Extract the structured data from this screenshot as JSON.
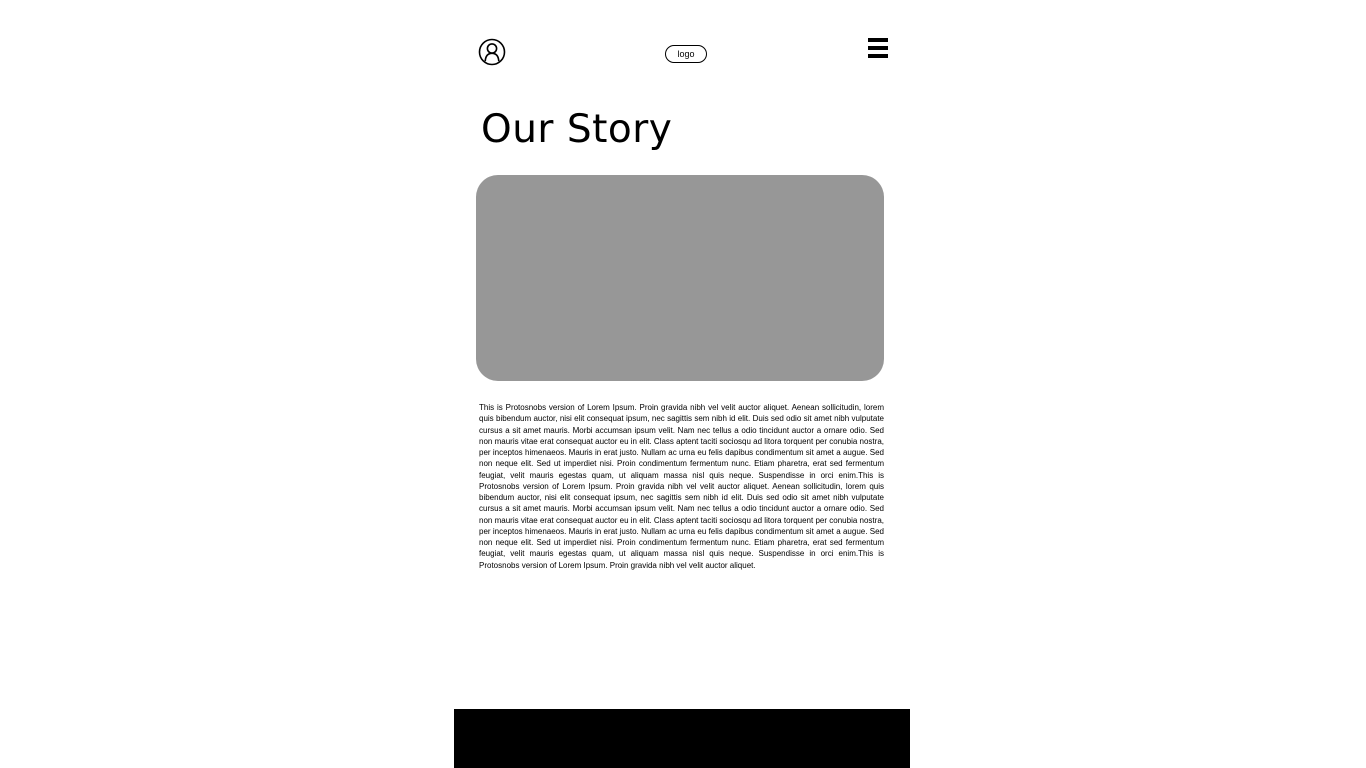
{
  "header": {
    "logo_text": "logo",
    "user_icon": "user-profile-icon",
    "menu_icon": "hamburger-menu-icon"
  },
  "main": {
    "title": "Our Story",
    "body": "This is Protosnobs version of Lorem Ipsum. Proin gravida nibh vel velit auctor aliquet. Aenean sollicitudin, lorem quis bibendum auctor, nisi elit consequat ipsum, nec sagittis sem nibh id elit. Duis sed odio sit amet nibh vulputate cursus a sit amet mauris. Morbi accumsan ipsum velit. Nam nec tellus a odio tincidunt auctor a ornare odio. Sed non mauris vitae erat consequat auctor eu in elit. Class aptent taciti sociosqu ad litora torquent per conubia nostra, per inceptos himenaeos. Mauris in erat justo. Nullam ac urna eu felis dapibus condimentum sit amet a augue. Sed non neque elit. Sed ut imperdiet nisi. Proin condimentum fermentum nunc. Etiam pharetra, erat sed fermentum feugiat, velit mauris egestas quam, ut aliquam massa nisl quis neque. Suspendisse in orci enim.This is Protosnobs version of Lorem Ipsum. Proin gravida nibh vel velit auctor aliquet. Aenean sollicitudin, lorem quis bibendum auctor, nisi elit consequat ipsum, nec sagittis sem nibh id elit. Duis sed odio sit amet nibh vulputate cursus a sit amet mauris. Morbi accumsan ipsum velit. Nam nec tellus a odio tincidunt auctor a ornare odio. Sed non mauris vitae erat consequat auctor eu in elit. Class aptent taciti sociosqu ad litora torquent per conubia nostra, per inceptos himenaeos. Mauris in erat justo. Nullam ac urna eu felis dapibus condimentum sit amet a augue. Sed non neque elit. Sed ut imperdiet nisi. Proin condimentum fermentum nunc. Etiam pharetra, erat sed fermentum feugiat, velit mauris egestas quam, ut aliquam massa nisl quis neque. Suspendisse in orci enim.This is Protosnobs version of Lorem Ipsum. Proin gravida nibh vel velit auctor aliquet."
  },
  "colors": {
    "background": "#ffffff",
    "image_placeholder": "#979797",
    "footer": "#000000",
    "text": "#000000"
  }
}
